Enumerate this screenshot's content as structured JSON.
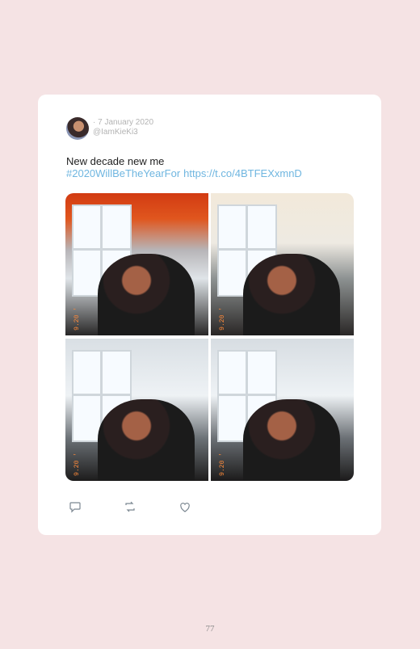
{
  "tweet": {
    "date": "· 7 January 2020",
    "handle": "@IamKieKi3",
    "text": "New decade new me",
    "hashtag": "#2020WillBeTheYearFor",
    "link": "https://t.co/4BTFEXxmnD"
  },
  "photos": [
    {
      "stamp": "9.20 '"
    },
    {
      "stamp": "9.20 '"
    },
    {
      "stamp": "9.20 '"
    },
    {
      "stamp": "9.20 '"
    }
  ],
  "actions": {
    "reply": "reply-icon",
    "retweet": "retweet-icon",
    "like": "heart-icon"
  },
  "page": {
    "number": "77"
  },
  "colors": {
    "background": "#f5e3e4",
    "link": "#6fb6e0",
    "card": "#ffffff"
  }
}
